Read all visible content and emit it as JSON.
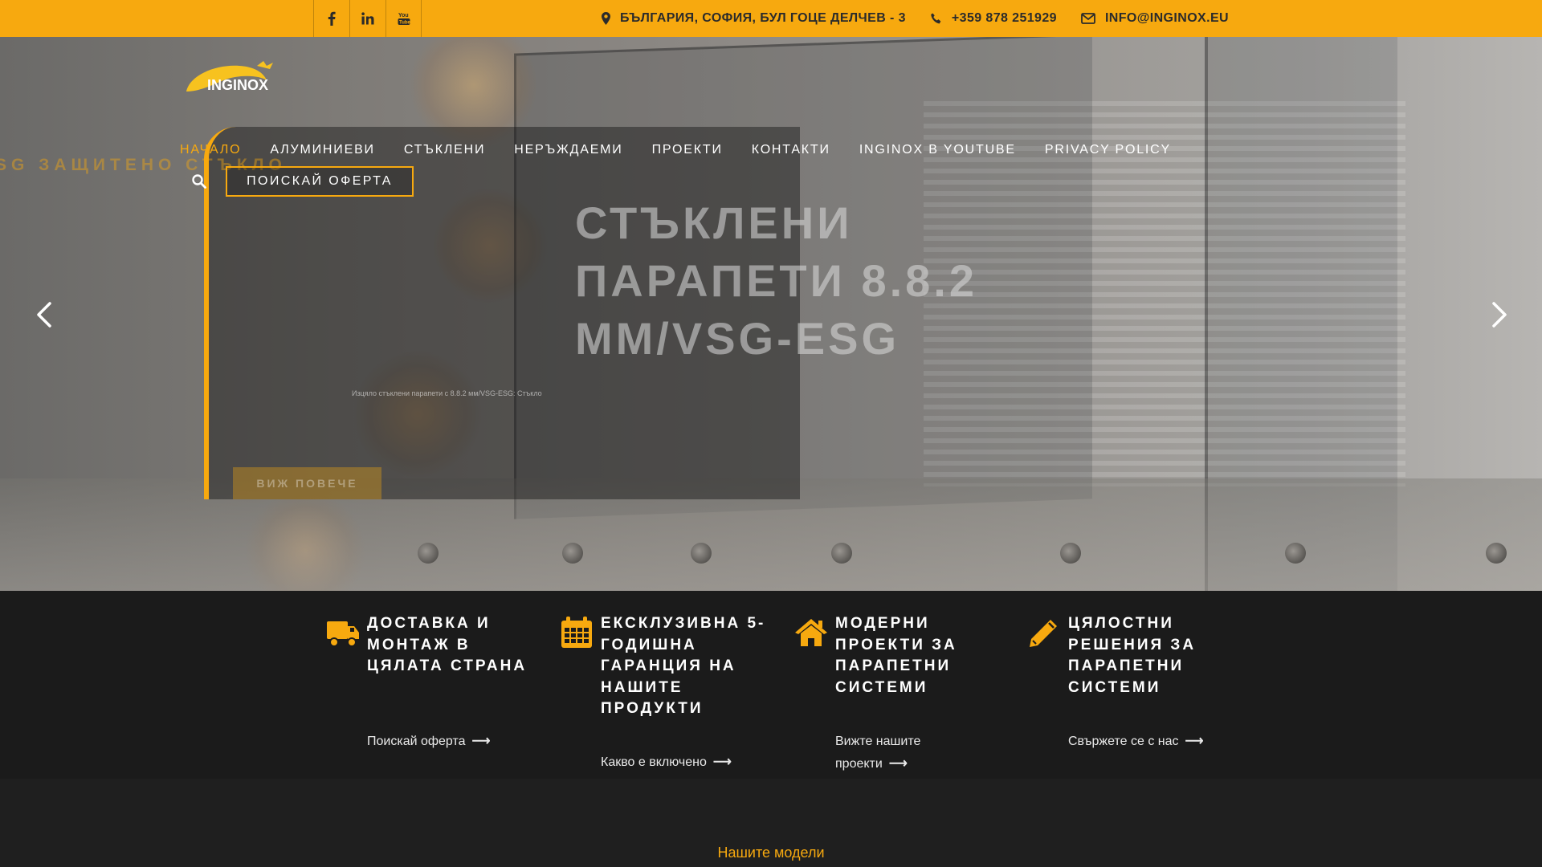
{
  "topbar": {
    "social": [
      "f",
      "in",
      "yt"
    ],
    "address": "БЪЛГАРИЯ, СОФИЯ, БУЛ ГОЦЕ ДЕЛЧЕВ - 3",
    "phone": "+359 878 251929",
    "email": "INFO@INGINOX.EU"
  },
  "logo": {
    "text": "INGINOX"
  },
  "nav": {
    "items": [
      "НАЧАЛО",
      "АЛУМИНИЕВИ",
      "СТЪКЛЕНИ",
      "НЕРЪЖДАЕМИ",
      "ПРОЕКТИ",
      "КОНТАКТИ",
      "INGINOX В YOUTUBE",
      "PRIVACY POLICY"
    ],
    "quote_button": "ПОИСКАЙ ОФЕРТА"
  },
  "hero": {
    "watermark": "SG ЗАЩИТЕНО СТЪКЛО",
    "title": "СТЪКЛЕНИ ПАРАПЕТИ 8.8.2 ММ/VSG-ESG",
    "subtitle": "Изцяло стъклени парапети с 8.8.2 мм/VSG-ESG: Стъкло",
    "button": "ВИЖ ПОВЕЧЕ"
  },
  "features": [
    {
      "icon": "truck-icon",
      "title": "ДОСТАВКА И МОНТАЖ В ЦЯЛАТА СТРАНА",
      "link": "Поискай оферта"
    },
    {
      "icon": "calendar-icon",
      "title": "ЕКСКЛУЗИВНА 5-ГОДИШНА ГАРАНЦИЯ НА НАШИТЕ ПРОДУКТИ",
      "link": "Какво е включено"
    },
    {
      "icon": "home-icon",
      "title": "МОДЕРНИ ПРОЕКТИ ЗА ПАРАПЕТНИ СИСТЕМИ",
      "link": "Вижте нашите проекти"
    },
    {
      "icon": "pencil-icon",
      "title": "ЦЯЛОСТНИ РЕШЕНИЯ ЗА ПАРАПЕТНИ СИСТЕМИ",
      "link": "Свържете се с нас"
    }
  ],
  "models": {
    "title": "Нашите модели"
  },
  "colors": {
    "accent": "#f7a90f",
    "dark": "#1b1b1b"
  }
}
